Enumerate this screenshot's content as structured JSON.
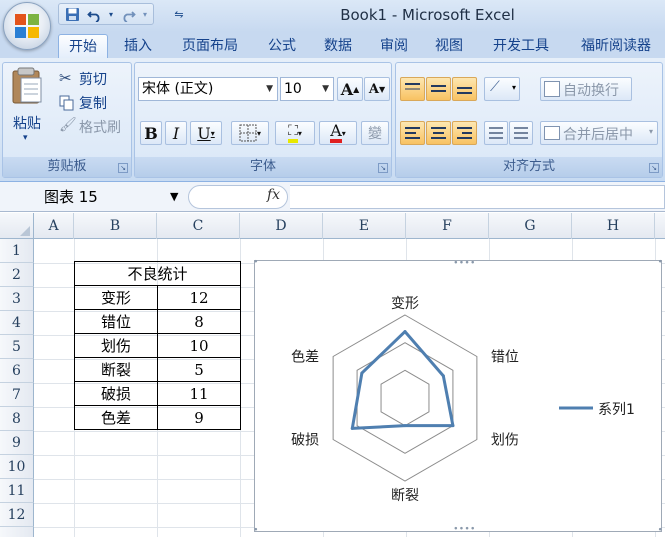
{
  "window": {
    "title": "Book1 - Microsoft Excel"
  },
  "quick_access": {
    "save_icon": "save-icon",
    "undo_icon": "undo-icon",
    "redo_icon": "redo-icon",
    "customize_icon": "customize-icon"
  },
  "tabs": [
    {
      "label": "开始",
      "active": true
    },
    {
      "label": "插入"
    },
    {
      "label": "页面布局"
    },
    {
      "label": "公式"
    },
    {
      "label": "数据"
    },
    {
      "label": "审阅"
    },
    {
      "label": "视图"
    },
    {
      "label": "开发工具"
    },
    {
      "label": "福昕阅读器"
    }
  ],
  "ribbon": {
    "clipboard": {
      "label": "剪贴板",
      "paste": "粘贴",
      "cut": "剪切",
      "copy": "复制",
      "format_painter": "格式刷"
    },
    "font": {
      "label": "字体",
      "font_name": "宋体 (正文)",
      "font_size": "10",
      "bold": "B",
      "italic": "I",
      "underline": "U",
      "grow": "A",
      "shrink": "A",
      "font_color": "A",
      "phonetic": "變"
    },
    "alignment": {
      "label": "对齐方式",
      "wrap_text": "自动换行",
      "merge_center": "合并后居中"
    }
  },
  "formula_bar": {
    "name_box": "图表 15",
    "fx": "fx",
    "formula": ""
  },
  "columns": [
    "A",
    "B",
    "C",
    "D",
    "E",
    "F",
    "G",
    "H"
  ],
  "rows": [
    "1",
    "2",
    "3",
    "4",
    "5",
    "6",
    "7",
    "8",
    "9",
    "10",
    "11",
    "12"
  ],
  "table": {
    "title": "不良统计",
    "rows": [
      {
        "name": "变形",
        "value": "12"
      },
      {
        "name": "错位",
        "value": "8"
      },
      {
        "name": "划伤",
        "value": "10"
      },
      {
        "name": "断裂",
        "value": "5"
      },
      {
        "name": "破损",
        "value": "11"
      },
      {
        "name": "色差",
        "value": "9"
      }
    ]
  },
  "chart_data": {
    "type": "radar",
    "categories": [
      "变形",
      "错位",
      "划伤",
      "断裂",
      "破损",
      "色差"
    ],
    "series": [
      {
        "name": "系列1",
        "values": [
          12,
          8,
          10,
          5,
          11,
          9
        ],
        "color": "#4f7fb0"
      }
    ],
    "ylim": [
      0,
      15
    ],
    "gridlines": [
      5,
      10,
      15
    ],
    "legend": "right"
  },
  "colors": {
    "accent": "#15428b",
    "series": "#4f7fb0",
    "selection_orange": "#f8c262"
  }
}
